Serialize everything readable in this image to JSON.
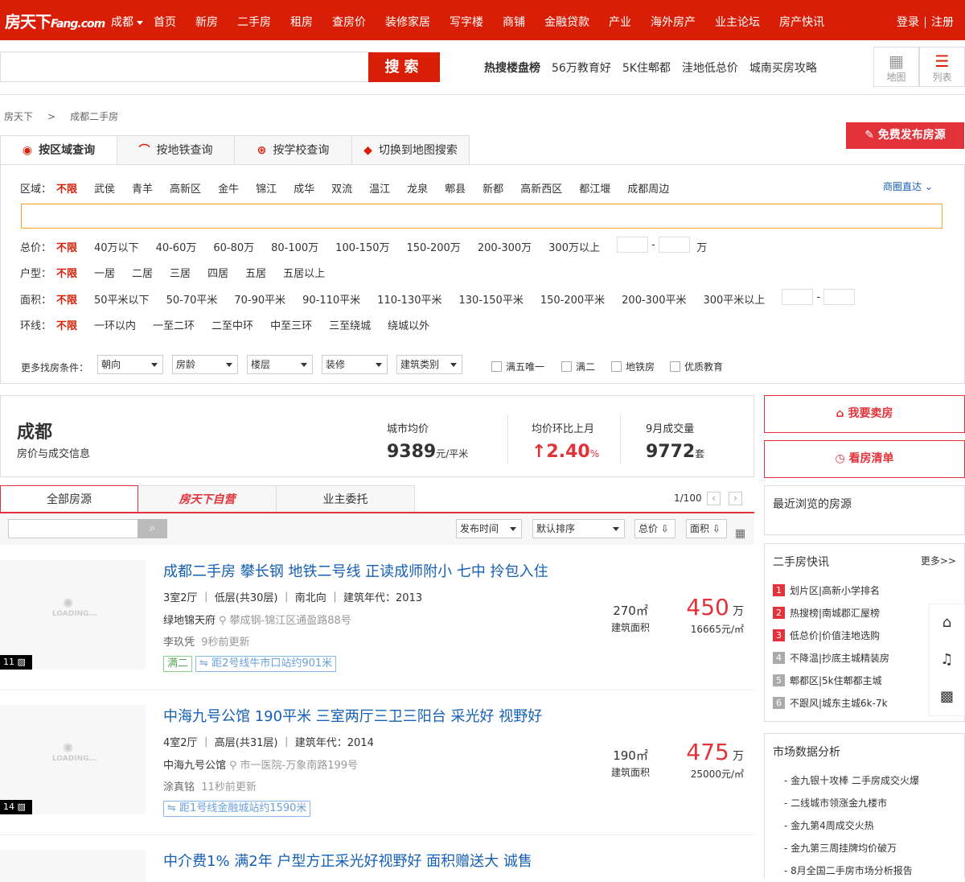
{
  "topnav": {
    "logo_a": "房天下",
    "logo_b": "Fang.com",
    "city": "成都",
    "items": [
      "首页",
      "新房",
      "二手房",
      "租房",
      "查房价",
      "装修家居",
      "写字楼",
      "商铺",
      "金融贷款",
      "产业",
      "海外房产",
      "业主论坛",
      "房产快讯"
    ],
    "login": "登录",
    "register": "注册"
  },
  "search": {
    "placeholder": "",
    "button": "搜索",
    "hot": [
      "热搜楼盘榜",
      "56万教育好",
      "5K住郫都",
      "洼地低总价",
      "城南买房攻略"
    ]
  },
  "view": {
    "map": "地图",
    "list": "列表"
  },
  "breadcrumb": [
    "房天下",
    ">",
    "成都二手房"
  ],
  "publish": "免费发布房源",
  "tabs": [
    "按区域查询",
    "按地铁查询",
    "按学校查询",
    "切换到地图搜索"
  ],
  "filters": {
    "district": {
      "label": "区域：",
      "options": [
        "不限",
        "武侯",
        "青羊",
        "高新区",
        "金牛",
        "锦江",
        "成华",
        "双流",
        "温江",
        "龙泉",
        "郫县",
        "新都",
        "高新西区",
        "都江堰",
        "成都周边"
      ]
    },
    "biz": "商圈直达",
    "price": {
      "label": "总价：",
      "options": [
        "不限",
        "40万以下",
        "40-60万",
        "60-80万",
        "80-100万",
        "100-150万",
        "150-200万",
        "200-300万",
        "300万以上"
      ],
      "unit": "万"
    },
    "layout": {
      "label": "户型：",
      "options": [
        "不限",
        "一居",
        "二居",
        "三居",
        "四居",
        "五居",
        "五居以上"
      ]
    },
    "area": {
      "label": "面积：",
      "options": [
        "不限",
        "50平米以下",
        "50-70平米",
        "70-90平米",
        "90-110平米",
        "110-130平米",
        "130-150平米",
        "150-200平米",
        "200-300平米",
        "300平米以上"
      ]
    },
    "ring": {
      "label": "环线：",
      "options": [
        "不限",
        "一环以内",
        "一至二环",
        "二至中环",
        "中至三环",
        "三至绕城",
        "绕城以外"
      ]
    }
  },
  "more": {
    "label": "更多找房条件：",
    "dropdowns": [
      "朝向",
      "房龄",
      "楼层",
      "装修",
      "建筑类别"
    ],
    "checks": [
      "满五唯一",
      "满二",
      "地铁房",
      "优质教育"
    ]
  },
  "city": {
    "name": "成都",
    "sub": "房价与成交信息",
    "avg_label": "城市均价",
    "avg": "9389",
    "avg_unit": "元/平米",
    "mom_label": "均价环比上月",
    "mom": "↑2.40",
    "mom_unit": "%",
    "deal_label": "9月成交量",
    "deal": "9772",
    "deal_unit": "套"
  },
  "side_buttons": {
    "sell": "我要卖房",
    "list": "看房清单"
  },
  "list_tabs": [
    "全部房源",
    "房天下自营",
    "业主委托"
  ],
  "pager": "1/100",
  "sorts": [
    "发布时间",
    "默认排序",
    "总价",
    "面积"
  ],
  "listings": [
    {
      "title": "成都二手房 攀长钢 地铁二号线 正读成师附小 七中 拎包入住",
      "info": "3室2厅 ｜ 低层(共30层) ｜ 南北向 ｜ 建筑年代：2013",
      "estate": "绿地锦天府",
      "addr": "攀成钢-锦江区通盈路88号",
      "agent": "李玖凭",
      "upd": "9秒前更新",
      "tags": [
        "满二",
        "距2号线牛市口站约901米"
      ],
      "area": "270㎡",
      "area_label": "建筑面积",
      "price": "450",
      "price_unit": "万",
      "unit_price": "16665元/㎡",
      "photos": "11"
    },
    {
      "title": "中海九号公馆 190平米 三室两厅三卫三阳台 采光好 视野好",
      "info": "4室2厅 ｜ 高层(共31层) ｜ 建筑年代：2014",
      "estate": "中海九号公馆",
      "addr": "市一医院-万象南路199号",
      "agent": "涂真铭",
      "upd": "11秒前更新",
      "tags": [
        "距1号线金融城站约1590米"
      ],
      "area": "190㎡",
      "area_label": "建筑面积",
      "price": "475",
      "price_unit": "万",
      "unit_price": "25000元/㎡",
      "photos": "14"
    },
    {
      "title": "中介费1% 满2年 户型方正采光好视野好 面积赠送大 诚售"
    }
  ],
  "loading": "LOADING...",
  "recent": "最近浏览的房源",
  "news": {
    "title": "二手房快讯",
    "more": "更多>>",
    "items": [
      "划片区|高新小学排名",
      "热搜榜|南城郡汇屋榜",
      "低总价|价值洼地选购",
      "不降温|抄底主城精装房",
      "郫都区|5k住郫都主城",
      "不跟风|城东主城6k-7k"
    ]
  },
  "market": {
    "title": "市场数据分析",
    "items": [
      "金九银十攻棒 二手房成交火爆",
      "二线城市领涨金九楼市",
      "金九第4周成交火热",
      "金九第三周挂牌均价破万",
      "8月全国二手房市场分析报告"
    ]
  }
}
